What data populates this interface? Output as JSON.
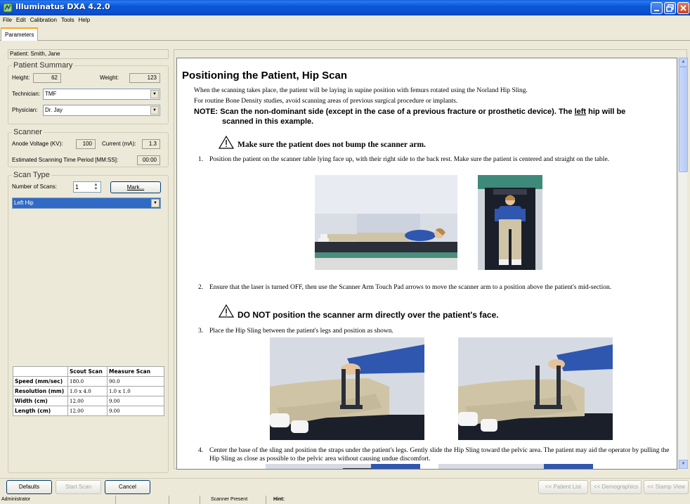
{
  "window": {
    "title": "Illuminatus DXA 4.2.0",
    "controls": [
      "minimize",
      "maximize",
      "close"
    ]
  },
  "menu": [
    "File",
    "Edit",
    "Calibration",
    "Tools",
    "Help"
  ],
  "tabs": [
    {
      "label": "Parameters",
      "active": true
    }
  ],
  "patient": {
    "label": "Patient:",
    "name": "Smith, Jane"
  },
  "patient_summary": {
    "title": "Patient Summary",
    "height_label": "Height:",
    "height_value": "62",
    "weight_label": "Weight:",
    "weight_value": "123",
    "technician_label": "Technician:",
    "technician_value": "TMF",
    "physician_label": "Physician:",
    "physician_value": "Dr. Jay"
  },
  "scanner": {
    "title": "Scanner",
    "voltage_label": "Anode Voltage (KV):",
    "voltage_value": "100",
    "current_label": "Current (mA):",
    "current_value": "1.3",
    "time_label": "Estimated Scanning Time Period [MM:SS]:",
    "time_value": "00:00"
  },
  "scan_type": {
    "title": "Scan Type",
    "num_label": "Number of Scans:",
    "num_value": "1",
    "mark_button": "Mark...",
    "selected": "Left Hip"
  },
  "scan_table": {
    "columns": [
      "",
      "Scout Scan",
      "Measure Scan"
    ],
    "rows": [
      [
        "Speed (mm/sec)",
        "180.0",
        "90.0"
      ],
      [
        "Resolution (mm)",
        "1.0 x 4.0",
        "1.0 x 1.0"
      ],
      [
        "Width (cm)",
        "12.00",
        "9.00"
      ],
      [
        "Length (cm)",
        "12.00",
        "9.00"
      ]
    ]
  },
  "document": {
    "heading": "Positioning the Patient, Hip Scan",
    "intro1": "When the scanning takes place, the patient will be laying in supine position with femurs rotated using the Norland Hip Sling.",
    "intro2": "For routine Bone Density studies, avoid scanning areas of previous surgical procedure or implants.",
    "note_prefix": "NOTE:  Scan the non-dominant side (except in the case of a previous fracture or prosthetic device). The ",
    "note_emph": "left",
    "note_suffix": " hip will be",
    "note_line2": "scanned in this example.",
    "warning1": "Make sure the patient does not bump the scanner arm.",
    "step1_num": "1.",
    "step1": "Position the patient on the scanner table lying face up, with their right side to the back rest. Make sure the patient is centered and straight on the table.",
    "step2_num": "2.",
    "step2": "Ensure that the laser is turned OFF, then use the Scanner Arm Touch Pad arrows to move the scanner arm to a position above the patient's mid-section.",
    "warning2": "DO NOT position the scanner arm directly over the patient's face.",
    "step3_num": "3.",
    "step3": "Place the Hip Sling between the patient's legs and position as shown.",
    "step4_num": "4.",
    "step4": "Center the base of the sling and position the straps under the patient's legs. Gently slide the Hip Sling toward the pelvic area. The patient may aid the operator by pulling the Hip Sling as close as possible to the pelvic area without causing undue discomfort."
  },
  "buttons": {
    "defaults": "Defaults",
    "start_scan": "Start Scan",
    "cancel": "Cancel",
    "patient_list": "<< Patient List",
    "demographics": "<< Demographics",
    "stamp_view": "<< Stamp View"
  },
  "status": {
    "user": "Administrator",
    "scanner": "Scanner Present",
    "hint_label": "Hint:"
  },
  "colors": {
    "titlebar": "#0a4fcf",
    "selection": "#316ac5",
    "scan_bed": "#1b1f2a",
    "scan_bed_accent": "#3e8a7a",
    "shirt": "#2f57b0",
    "pants": "#cfc5a6"
  }
}
